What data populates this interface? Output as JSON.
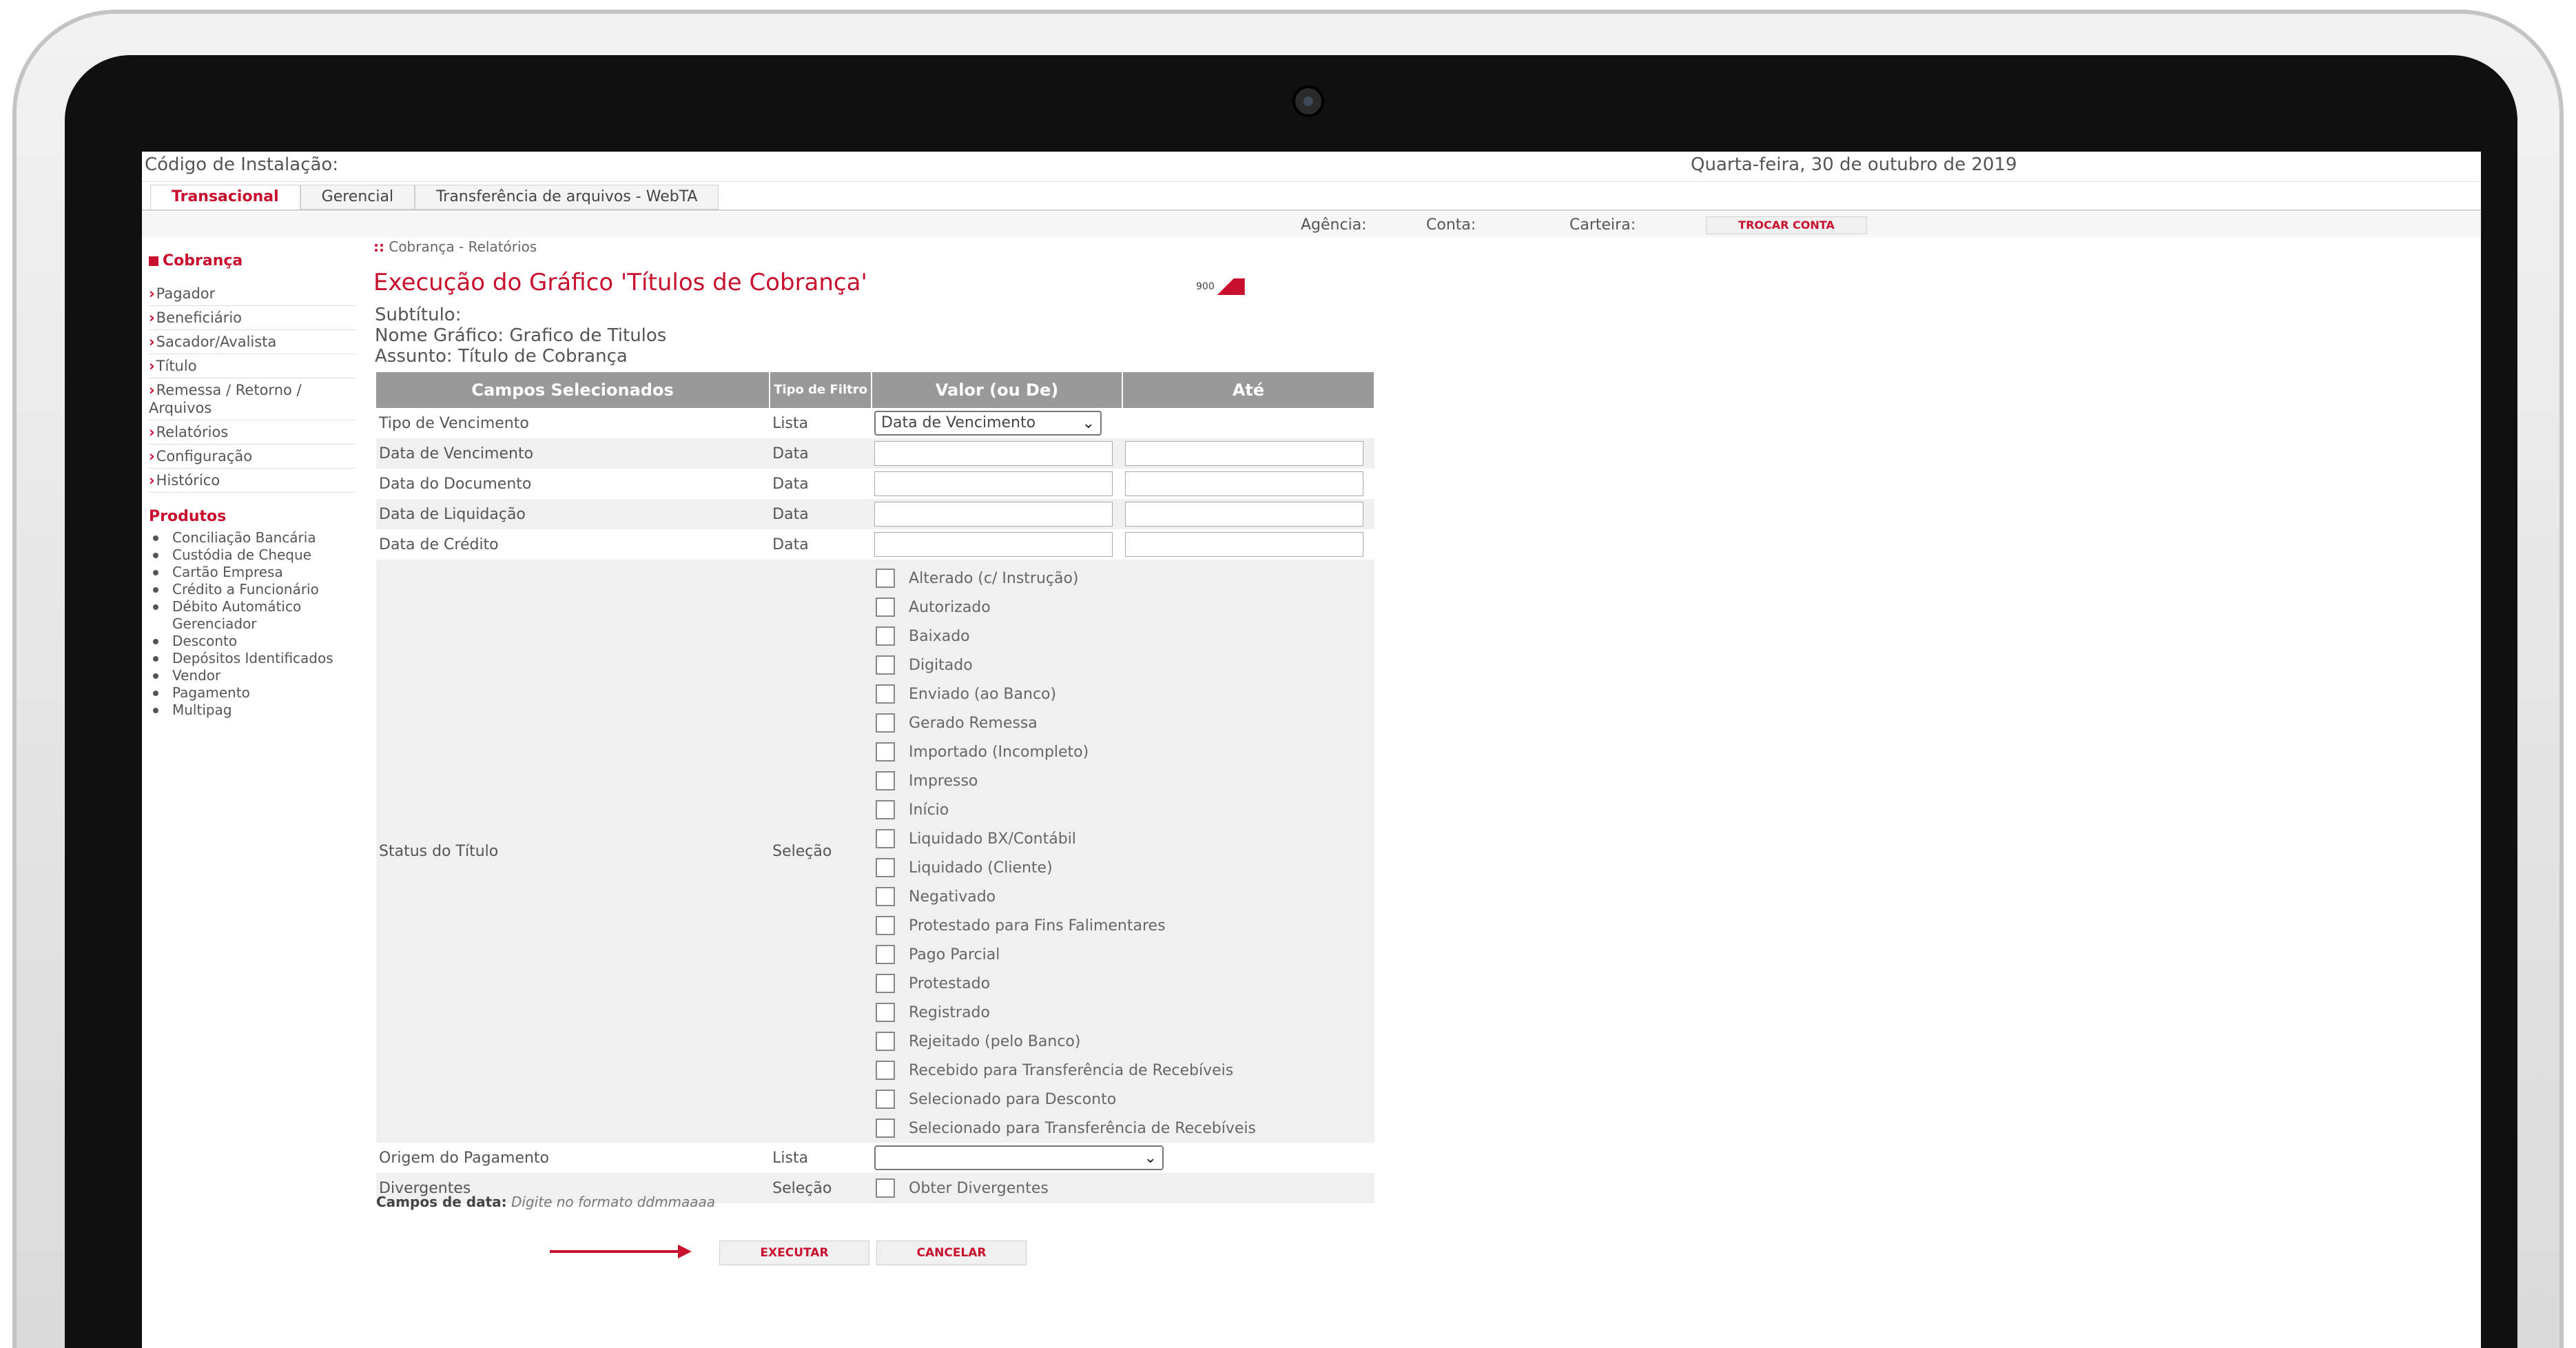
{
  "header": {
    "install_code": "Código de Instalação:",
    "date": "Quarta-feira, 30 de outubro de 2019"
  },
  "tabs": [
    {
      "label": "Transacional",
      "active": true
    },
    {
      "label": "Gerencial",
      "active": false
    },
    {
      "label": "Transferência de arquivos - WebTA",
      "active": false
    }
  ],
  "account_bar": {
    "agencia": "Agência:",
    "conta": "Conta:",
    "carteira": "Carteira:",
    "trocar_label": "TROCAR CONTA"
  },
  "sidebar": {
    "title": "Cobrança",
    "items": [
      {
        "label": "Pagador"
      },
      {
        "label": "Beneficiário"
      },
      {
        "label": "Sacador/Avalista"
      },
      {
        "label": "Título"
      },
      {
        "label": "Remessa / Retorno / Arquivos"
      },
      {
        "label": "Relatórios"
      },
      {
        "label": "Configuração"
      },
      {
        "label": "Histórico"
      }
    ],
    "products_title": "Produtos",
    "products": [
      "Conciliação Bancária",
      "Custódia de Cheque",
      "Cartão Empresa",
      "Crédito a Funcionário",
      "Débito Automático Gerenciador",
      "Desconto",
      "Depósitos Identificados",
      "Vendor",
      "Pagamento",
      "Multipag"
    ]
  },
  "main": {
    "breadcrumb": "Cobrança - Relatórios",
    "title": "Execução do Gráfico 'Títulos de Cobrança'",
    "logo_text": "900",
    "subtitle": "Subtítulo:",
    "graph_name": "Nome Gráfico: Grafico de Titulos",
    "subject": "Assunto: Título de Cobrança"
  },
  "table": {
    "headers": [
      "Campos Selecionados",
      "Tipo de Filtro",
      "Valor (ou De)",
      "Até"
    ],
    "rows": [
      {
        "field": "Tipo de Vencimento",
        "type": "Lista",
        "select_value": "Data de Vencimento"
      },
      {
        "field": "Data de Vencimento",
        "type": "Data"
      },
      {
        "field": "Data do Documento",
        "type": "Data"
      },
      {
        "field": "Data de Liquidação",
        "type": "Data"
      },
      {
        "field": "Data de Crédito",
        "type": "Data"
      }
    ],
    "status": {
      "field": "Status do Título",
      "type": "Seleção",
      "options": [
        "Alterado (c/ Instrução)",
        "Autorizado",
        "Baixado",
        "Digitado",
        "Enviado (ao Banco)",
        "Gerado Remessa",
        "Importado (Incompleto)",
        "Impresso",
        "Início",
        "Liquidado BX/Contábil",
        "Liquidado (Cliente)",
        "Negativado",
        "Protestado para Fins Falimentares",
        "Pago Parcial",
        "Protestado",
        "Registrado",
        "Rejeitado (pelo Banco)",
        "Recebido para Transferência de Recebíveis",
        "Selecionado para Desconto",
        "Selecionado para Transferência de Recebíveis"
      ]
    },
    "origem": {
      "field": "Origem do Pagamento",
      "type": "Lista",
      "select_value": ""
    },
    "divergentes": {
      "field": "Divergentes",
      "type": "Seleção",
      "option": "Obter Divergentes"
    }
  },
  "hint": {
    "bold": "Campos de data:",
    "italic": "Digite no formato ddmmaaaa"
  },
  "actions": {
    "execute_label": "EXECUTAR",
    "cancel_label": "CANCELAR"
  },
  "colors": {
    "accent": "#c8102e",
    "header_bg": "#999999"
  }
}
